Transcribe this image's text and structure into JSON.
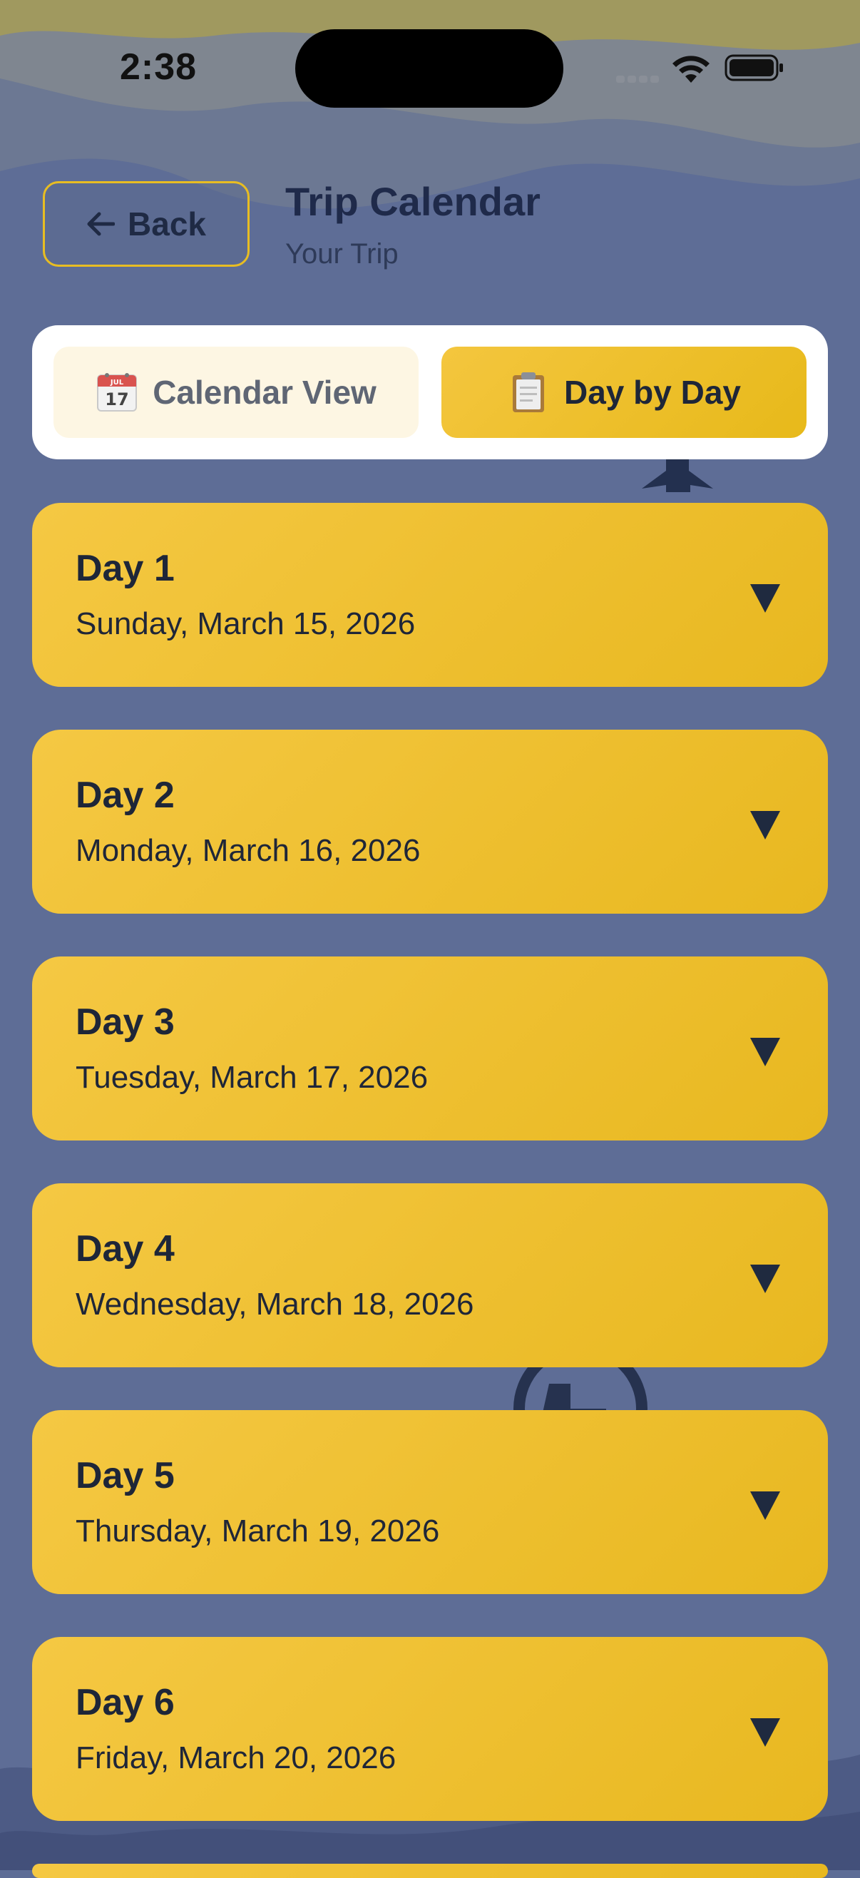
{
  "status_bar": {
    "time": "2:38"
  },
  "header": {
    "back_label": "Back",
    "title": "Trip Calendar",
    "subtitle": "Your Trip"
  },
  "view_toggle": {
    "calendar_label": "Calendar View",
    "day_by_day_label": "Day by Day",
    "active": "day_by_day"
  },
  "days": [
    {
      "title": "Day 1",
      "date": "Sunday, March 15, 2026"
    },
    {
      "title": "Day 2",
      "date": "Monday, March 16, 2026"
    },
    {
      "title": "Day 3",
      "date": "Tuesday, March 17, 2026"
    },
    {
      "title": "Day 4",
      "date": "Wednesday, March 18, 2026"
    },
    {
      "title": "Day 5",
      "date": "Thursday, March 19, 2026"
    },
    {
      "title": "Day 6",
      "date": "Friday, March 20, 2026"
    }
  ],
  "icons": {
    "back": "arrow-left-icon",
    "calendar": "calendar-icon",
    "clipboard": "clipboard-icon",
    "expand": "triangle-down-icon"
  },
  "colors": {
    "background": "#5e6d96",
    "accent": "#f2c53a",
    "text_dark": "#1e2638"
  }
}
